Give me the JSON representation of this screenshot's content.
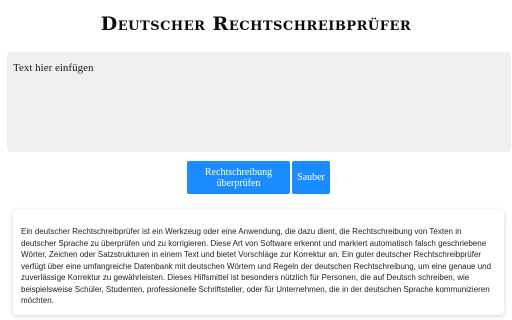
{
  "header": {
    "title": "Deutscher Rechtschreibprüfer"
  },
  "editor": {
    "placeholder": "Text hier einfügen",
    "value": ""
  },
  "actions": {
    "check_label": "Rechtschreibung überprüfen",
    "clean_label": "Sauber"
  },
  "info": {
    "text": "Ein deutscher Rechtschreibprüfer ist ein Werkzeug oder eine Anwendung, die dazu dient, die Rechtschreibung von Texten in deutscher Sprache zu überprüfen und zu korrigieren. Diese Art von Software erkennt und markiert automatisch falsch geschriebene Wörter, Zeichen oder Satzstrukturen in einem Text und bietet Vorschläge zur Korrektur an. Ein guter deutscher Rechtschreibprüfer verfügt über eine umfangreiche Datenbank mit deutschen Wörtern und Regeln der deutschen Rechtschreibung, um eine genaue und zuverlässige Korrektur zu gewährleisten. Dieses Hilfsmittel ist besonders nützlich für Personen, die auf Deutsch schreiben, wie beispielsweise Schüler, Studenten, professionelle Schriftsteller, oder für Unternehmen, die in der deutschen Sprache kommunizieren möchten."
  },
  "colors": {
    "accent": "#1a8cff",
    "editor_bg": "#efefef"
  }
}
